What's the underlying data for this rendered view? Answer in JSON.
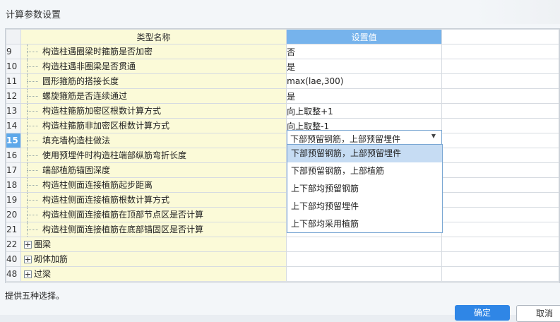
{
  "dialog": {
    "title": "计算参数设置",
    "status": "提供五种选择。",
    "ok_label": "确定",
    "cancel_label": "取消"
  },
  "grid": {
    "header": {
      "name": "类型名称",
      "value": "设置值"
    },
    "rows": [
      {
        "num": "9",
        "name": "构造柱遇圈梁时箍筋是否加密",
        "value": "否"
      },
      {
        "num": "10",
        "name": "构造柱遇非圈梁是否贯通",
        "value": "是"
      },
      {
        "num": "11",
        "name": "圆形箍筋的搭接长度",
        "value": "max(lae,300)"
      },
      {
        "num": "12",
        "name": "螺旋箍筋是否连续通过",
        "value": "是"
      },
      {
        "num": "13",
        "name": "构造柱箍筋加密区根数计算方式",
        "value": "向上取整+1"
      },
      {
        "num": "14",
        "name": "构造柱箍筋非加密区根数计算方式",
        "value": "向上取整-1"
      },
      {
        "num": "15",
        "name": "填充墙构造柱做法",
        "value": ""
      },
      {
        "num": "16",
        "name": "使用预埋件时构造柱端部纵筋弯折长度",
        "value": ""
      },
      {
        "num": "17",
        "name": "端部植筋锚固深度",
        "value": ""
      },
      {
        "num": "18",
        "name": "构造柱侧面连接植筋起步距离",
        "value": ""
      },
      {
        "num": "19",
        "name": "构造柱侧面连接植筋根数计算方式",
        "value": ""
      },
      {
        "num": "20",
        "name": "构造柱侧面连接植筋在顶部节点区是否计算",
        "value": ""
      },
      {
        "num": "21",
        "name": "构造柱侧面连接植筋在底部锚固区是否计算",
        "value": ""
      }
    ],
    "groups": [
      {
        "num": "22",
        "name": "圈梁"
      },
      {
        "num": "40",
        "name": "砌体加筋"
      },
      {
        "num": "48",
        "name": "过梁"
      }
    ]
  },
  "combo": {
    "value": "下部预留钢筋，上部预留埋件"
  },
  "dropdown": {
    "options": [
      "下部预留钢筋，上部预留埋件",
      "下部预留钢筋，上部植筋",
      "上下部均预留钢筋",
      "上下部均预留埋件",
      "上下部均采用植筋"
    ],
    "highlighted_index": 0
  }
}
